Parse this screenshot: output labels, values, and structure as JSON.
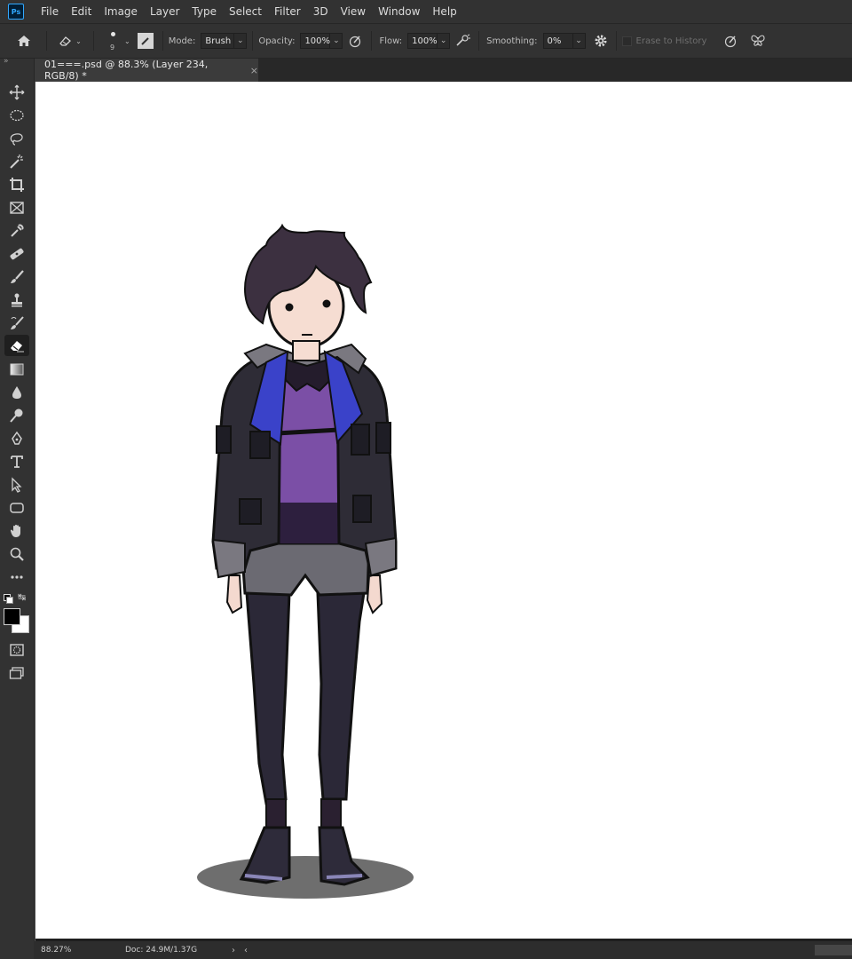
{
  "app": {
    "logo": "Ps"
  },
  "menu": [
    "File",
    "Edit",
    "Image",
    "Layer",
    "Type",
    "Select",
    "Filter",
    "3D",
    "View",
    "Window",
    "Help"
  ],
  "options": {
    "brush_size": "9",
    "mode_label": "Mode:",
    "mode_value": "Brush",
    "opacity_label": "Opacity:",
    "opacity_value": "100%",
    "flow_label": "Flow:",
    "flow_value": "100%",
    "smoothing_label": "Smoothing:",
    "smoothing_value": "0%",
    "erase_history_label": "Erase to History"
  },
  "tab": {
    "title": "01===.psd @ 88.3% (Layer 234, RGB/8) *",
    "close": "×"
  },
  "status": {
    "zoom": "88.27%",
    "doc": "Doc: 24.9M/1.37G",
    "arrow": "›",
    "left": "‹"
  },
  "toolbar_tools": [
    "move-icon",
    "ellipse-marquee-icon",
    "lasso-icon",
    "magic-wand-icon",
    "crop-icon",
    "frame-icon",
    "eyedropper-icon",
    "healing-brush-icon",
    "brush-icon",
    "clone-stamp-icon",
    "history-brush-icon",
    "eraser-icon",
    "gradient-icon",
    "blur-icon",
    "dodge-icon",
    "pen-icon",
    "type-icon",
    "path-selection-icon",
    "rectangle-icon",
    "hand-icon",
    "zoom-icon",
    "more-tools-icon"
  ],
  "colors": {
    "foreground": "#000000",
    "background": "#ffffff",
    "jacket": "#2e2c36",
    "shirt": "#7b4fa6",
    "collar": "#3a42c9",
    "hair": "#3c3040"
  }
}
